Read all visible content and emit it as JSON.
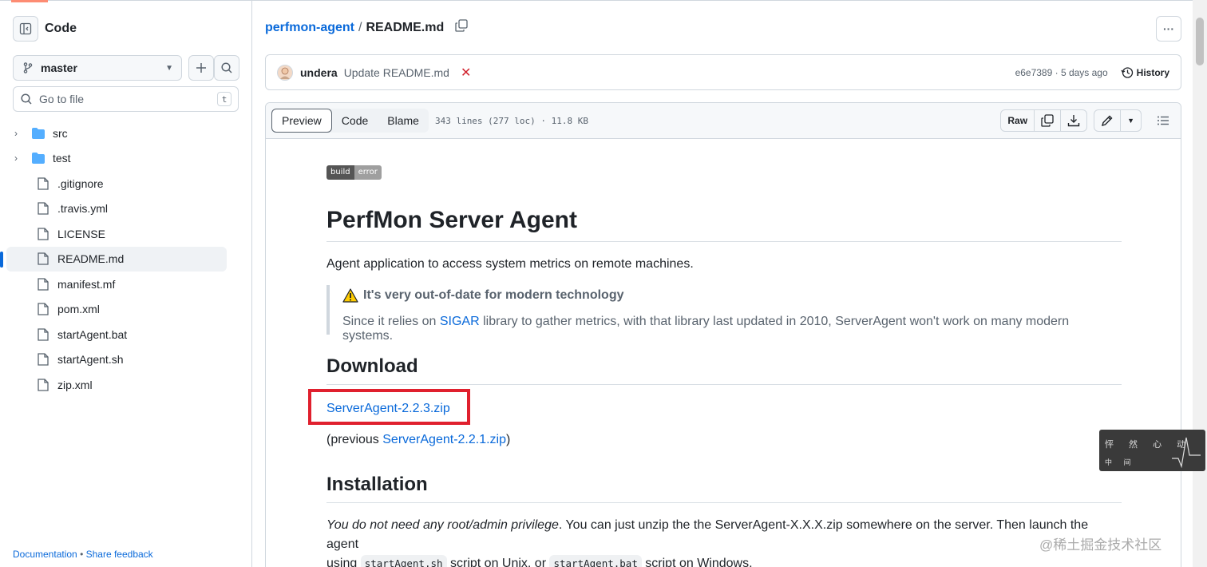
{
  "sidebar": {
    "title": "Code",
    "branch": "master",
    "goto_placeholder": "Go to file",
    "goto_shortcut": "t",
    "tree": [
      {
        "type": "folder",
        "name": "src"
      },
      {
        "type": "folder",
        "name": "test"
      },
      {
        "type": "file",
        "name": ".gitignore"
      },
      {
        "type": "file",
        "name": ".travis.yml"
      },
      {
        "type": "file",
        "name": "LICENSE"
      },
      {
        "type": "file",
        "name": "README.md",
        "active": true
      },
      {
        "type": "file",
        "name": "manifest.mf"
      },
      {
        "type": "file",
        "name": "pom.xml"
      },
      {
        "type": "file",
        "name": "startAgent.bat"
      },
      {
        "type": "file",
        "name": "startAgent.sh"
      },
      {
        "type": "file",
        "name": "zip.xml"
      }
    ],
    "footer": {
      "documentation": "Documentation",
      "separator": "•",
      "feedback": "Share feedback"
    }
  },
  "breadcrumb": {
    "repo": "perfmon-agent",
    "separator": "/",
    "file": "README.md"
  },
  "commit": {
    "author": "undera",
    "message": "Update README.md",
    "status": "✕",
    "meta": "e6e7389 · 5 days ago",
    "history_label": "History"
  },
  "file_header": {
    "tabs": [
      "Preview",
      "Code",
      "Blame"
    ],
    "active_tab": "Preview",
    "meta": "343 lines (277 loc) · 11.8 KB",
    "raw_label": "Raw"
  },
  "readme": {
    "badge": {
      "left": "build",
      "right": "error"
    },
    "title": "PerfMon Server Agent",
    "intro": "Agent application to access system metrics on remote machines.",
    "warning_title": "It's very out-of-date for modern technology",
    "warning_pre": "Since it relies on ",
    "warning_link": "SIGAR",
    "warning_post": " library to gather metrics, with that library last updated in 2010, ServerAgent won't work on many modern systems.",
    "download_heading": "Download",
    "download_link": "ServerAgent-2.2.3.zip",
    "previous_pre": "(previous ",
    "previous_link": "ServerAgent-2.2.1.zip",
    "previous_post": ")",
    "install_heading": "Installation",
    "install_em": "You do not need any root/admin privilege",
    "install_text1": ". You can just unzip the the ServerAgent-X.X.X.zip somewhere on the server. Then launch the agent",
    "install_text2": "using ",
    "install_code1": "startAgent.sh",
    "install_text3": " script on Unix, or ",
    "install_code2": "startAgent.bat",
    "install_text4": " script on Windows."
  },
  "overlay": {
    "widget_row1": "怦 然 心 动",
    "widget_row2": "中 间",
    "watermark": "@稀土掘金技术社区"
  },
  "colors": {
    "accent": "#0969da",
    "highlight_box": "#e0202e",
    "error": "#d1242f"
  }
}
